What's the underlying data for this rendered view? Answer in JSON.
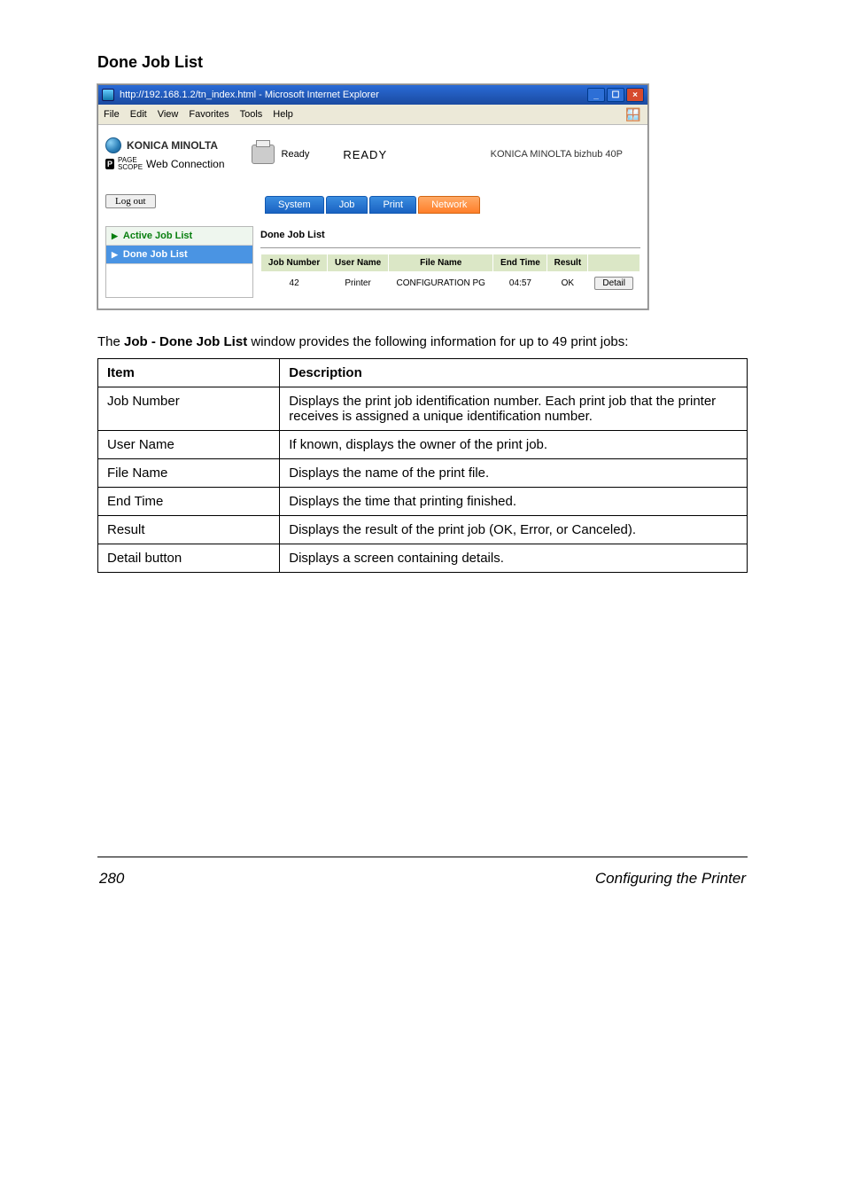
{
  "section_title": "Done Job List",
  "window": {
    "title": "http://192.168.1.2/tn_index.html - Microsoft Internet Explorer",
    "menus": [
      "File",
      "Edit",
      "View",
      "Favorites",
      "Tools",
      "Help"
    ],
    "brand_top": "KONICA MINOLTA",
    "brand_bottom": "Web Connection",
    "ps_label": "PAGE\nSCOPE",
    "ready_short": "Ready",
    "ready_big": "READY",
    "model": "KONICA MINOLTA bizhub 40P",
    "logout": "Log out",
    "tabs": [
      "System",
      "Job",
      "Print",
      "Network"
    ],
    "sidenav": [
      {
        "label": "Active Job List",
        "kind": "active"
      },
      {
        "label": "Done Job List",
        "kind": "done"
      }
    ],
    "pane_title": "Done Job List",
    "columns": [
      "Job Number",
      "User Name",
      "File Name",
      "End Time",
      "Result",
      ""
    ],
    "row": {
      "job_no": "42",
      "user": "Printer",
      "file": "CONFIGURATION PG",
      "end": "04:57",
      "result": "OK",
      "detail": "Detail"
    }
  },
  "caption_pre": "The ",
  "caption_bold": "Job - Done Job List",
  "caption_post": " window provides the following information for up to 49 print jobs:",
  "desc_header_item": "Item",
  "desc_header_desc": "Description",
  "desc_rows": [
    {
      "item": "Job Number",
      "desc": "Displays the print job identification number. Each print job that the printer receives is assigned a unique identification number."
    },
    {
      "item": "User Name",
      "desc": "If known, displays the owner of the print job."
    },
    {
      "item": "File Name",
      "desc": "Displays the name of the print file."
    },
    {
      "item": "End Time",
      "desc": "Displays the time that printing finished."
    },
    {
      "item": "Result",
      "desc": "Displays the result of the print job (OK, Error, or Canceled)."
    },
    {
      "item": "Detail button",
      "desc": "Displays a screen containing details."
    }
  ],
  "footer_page": "280",
  "footer_right": "Configuring the Printer"
}
